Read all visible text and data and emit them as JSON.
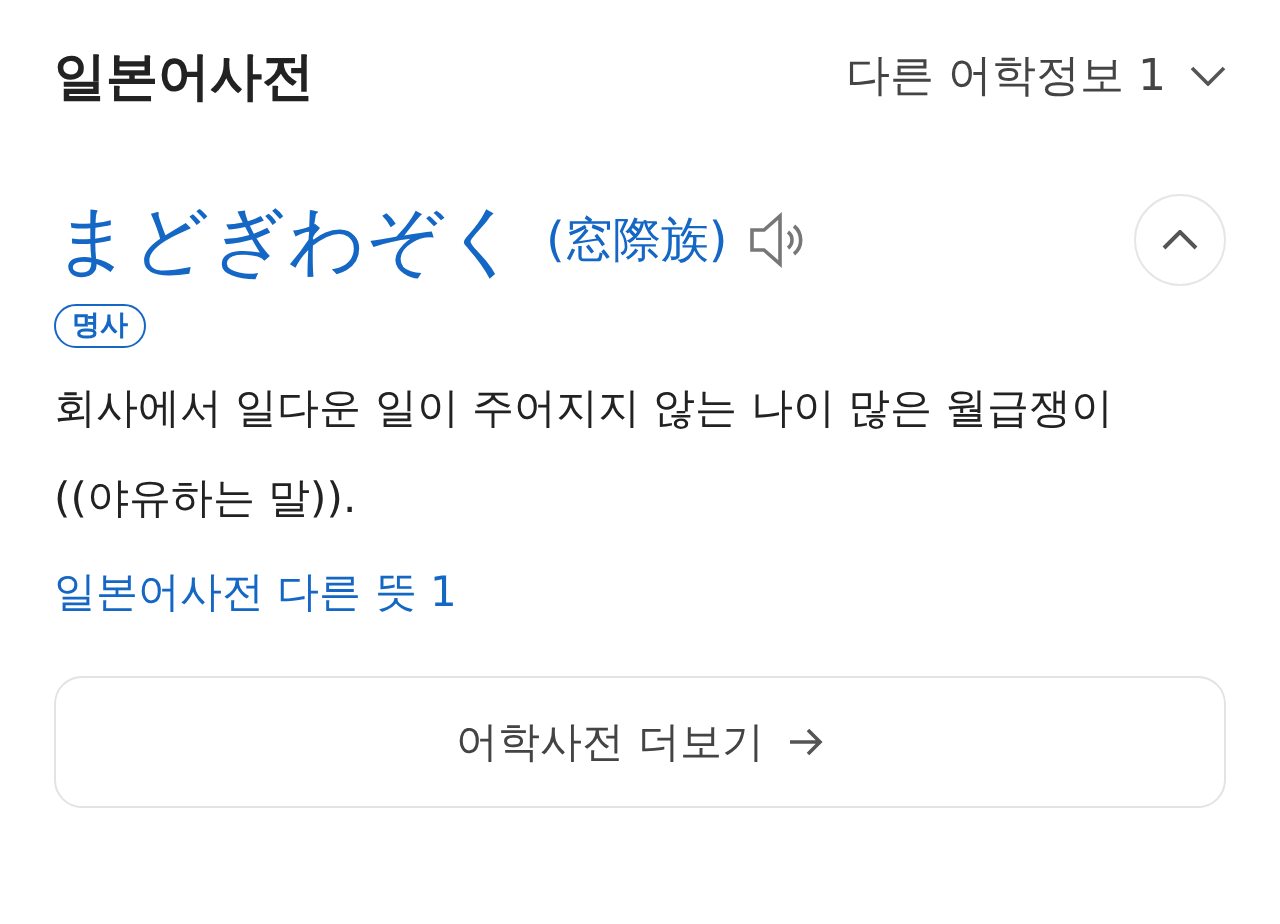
{
  "header": {
    "title": "일본어사전",
    "other_info": "다른 어학정보 1"
  },
  "entry": {
    "headword": "まどぎわぞく",
    "kanji": "(窓際族)",
    "expanded": true,
    "part_of_speech": "명사",
    "definition": "회사에서 일다운 일이 주어지지 않는 나이 많은 월급쟁이((야유하는 말)).",
    "other_meanings_link": "일본어사전 다른 뜻 1"
  },
  "more_button": {
    "label": "어학사전 더보기"
  }
}
